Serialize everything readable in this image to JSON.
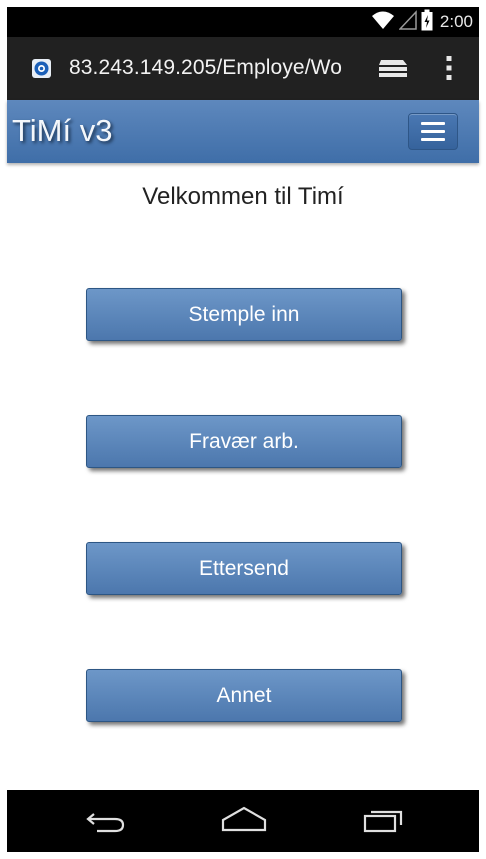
{
  "status_bar": {
    "time": "2:00",
    "icons": [
      "wifi-icon",
      "signal-icon",
      "battery-icon"
    ]
  },
  "browser": {
    "url": "83.243.149.205/Employe/Wo",
    "icons": [
      "favicon-icon",
      "tabs-icon",
      "overflow-menu-icon"
    ]
  },
  "app_header": {
    "title": "TiMí v3",
    "menu_icon": "hamburger-icon"
  },
  "main": {
    "welcome": "Velkommen til Timí",
    "buttons": [
      {
        "label": "Stemple inn"
      },
      {
        "label": "Fravær arb."
      },
      {
        "label": "Ettersend"
      },
      {
        "label": "Annet"
      }
    ]
  },
  "nav_bar": {
    "icons": [
      "back-icon",
      "home-icon",
      "recent-apps-icon"
    ]
  },
  "colors": {
    "header_blue": "#4a78b3",
    "button_blue": "#5b86bb",
    "bar_black": "#000000"
  }
}
